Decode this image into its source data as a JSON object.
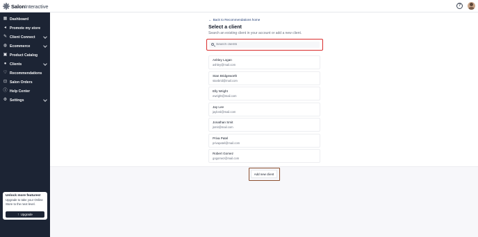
{
  "app": {
    "logo_bold": "Salon",
    "logo_light": "Interactive"
  },
  "topbar": {
    "help_icon": "question-circle-icon",
    "avatar_icon": "user-avatar"
  },
  "sidebar": {
    "items": [
      {
        "label": "Dashboard",
        "icon": "grid-icon",
        "expandable": false
      },
      {
        "label": "Promote my store",
        "icon": "megaphone-icon",
        "expandable": false
      },
      {
        "label": "Client Connect",
        "icon": "pencil-icon",
        "expandable": true
      },
      {
        "label": "Ecommerce",
        "icon": "globe-icon",
        "expandable": true
      },
      {
        "label": "Product Catalog",
        "icon": "box-icon",
        "expandable": false
      },
      {
        "label": "Clients",
        "icon": "users-icon",
        "expandable": true
      },
      {
        "label": "Recommendations",
        "icon": "heart-icon",
        "expandable": false
      },
      {
        "label": "Salon Orders",
        "icon": "cart-icon",
        "expandable": false
      },
      {
        "label": "Help Center",
        "icon": "info-icon",
        "expandable": false
      },
      {
        "label": "Settings",
        "icon": "gear-icon",
        "expandable": true
      }
    ],
    "upsell": {
      "title": "Unlock more features!",
      "text": "Upgrade to take your Online Store to the next level.",
      "button_label": "Upgrade"
    }
  },
  "main": {
    "back_link": "Back to Recommendations home",
    "title": "Select a client",
    "subtitle": "Search an existing client in your account or add a new client.",
    "search": {
      "placeholder": "Search clients",
      "value": ""
    },
    "clients": [
      {
        "name": "Ashley Logan",
        "email": "ashley@mail.com"
      },
      {
        "name": "Stan Bridgeworth",
        "email": "stanbrid@mail.com"
      },
      {
        "name": "Elly Wright",
        "email": "ewright@mail.com"
      },
      {
        "name": "Jay Lee",
        "email": "jaylord@mail.com"
      },
      {
        "name": "Jonathan Smit",
        "email": "jsmit@mail.com"
      },
      {
        "name": "Priva Patel",
        "email": "privapatel@mail.com"
      },
      {
        "name": "Robert Gomez",
        "email": "gogomez@mail.com"
      }
    ],
    "add_client_label": "Add new client"
  },
  "colors": {
    "sidebar_bg": "#1c2434",
    "highlight_red": "#d92b2b",
    "highlight_brown": "#8b4f2f",
    "link_blue": "#1f3b73"
  }
}
